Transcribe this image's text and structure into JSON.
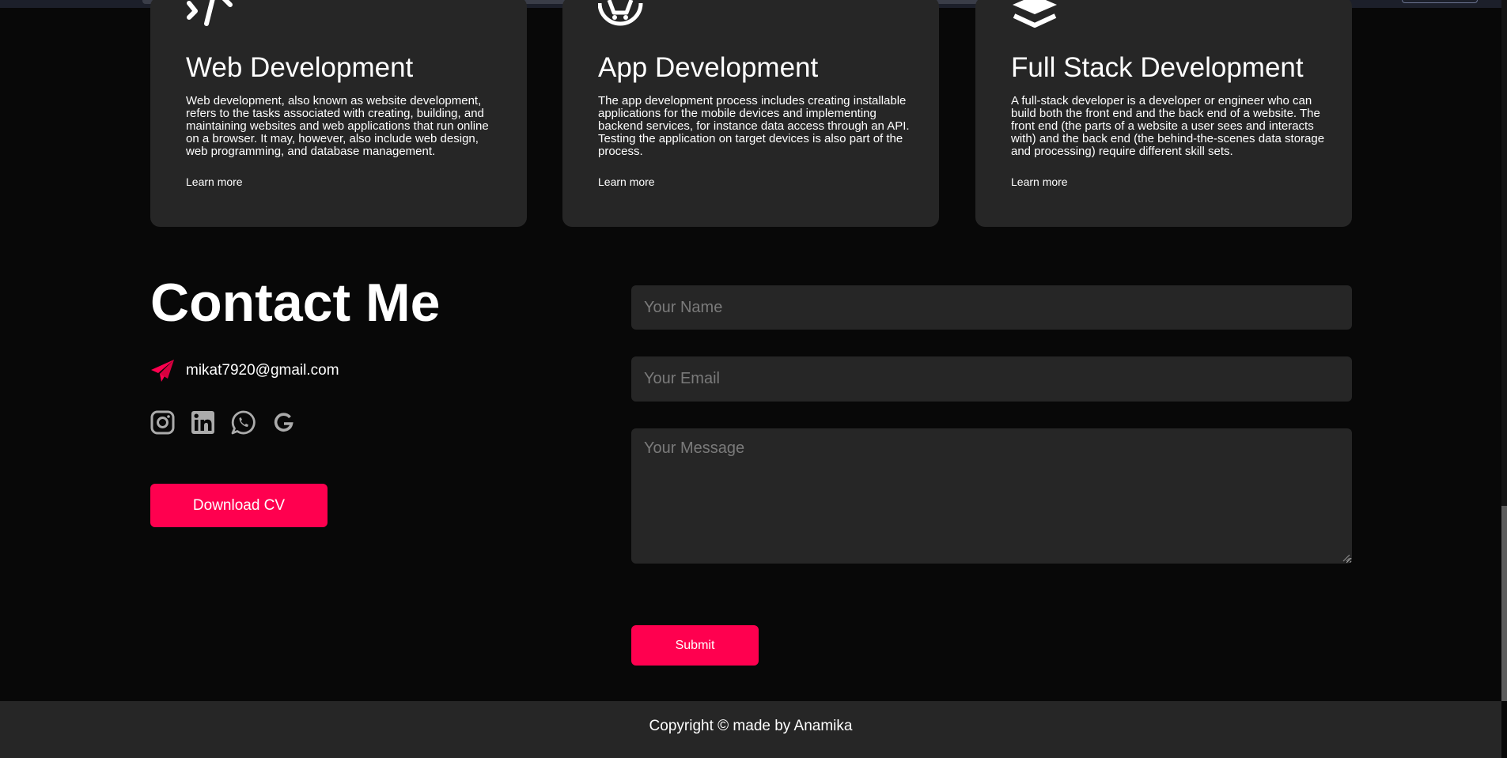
{
  "services": [
    {
      "icon": "code-icon",
      "title": "Web Development",
      "description": "Web development, also known as website development, refers to the tasks associated with creating, building, and maintaining websites and web applications that run online on a browser. It may, however, also include web design, web programming, and database management.",
      "link": "Learn more"
    },
    {
      "icon": "app-icon",
      "title": "App Development",
      "description": "The app development process includes creating installable applications for the mobile devices and implementing backend services, for instance data access through an API. Testing the application on target devices is also part of the process.",
      "link": "Learn more"
    },
    {
      "icon": "layers-icon",
      "title": "Full Stack Development",
      "description": "A full-stack developer is a developer or engineer who can build both the front end and the back end of a website. The front end (the parts of a website a user sees and interacts with) and the back end (the behind-the-scenes data storage and processing) require different skill sets.",
      "link": "Learn more"
    }
  ],
  "contact": {
    "title": "Contact Me",
    "email": "mikat7920@gmail.com",
    "socials": [
      "instagram-icon",
      "linkedin-icon",
      "whatsapp-icon",
      "google-icon"
    ],
    "download_label": "Download CV"
  },
  "form": {
    "name_placeholder": "Your Name",
    "email_placeholder": "Your Email",
    "message_placeholder": "Your Message",
    "submit_label": "Submit"
  },
  "footer": {
    "text": "Copyright © made by Anamika"
  },
  "colors": {
    "accent": "#ff004f",
    "background": "#080808",
    "card": "#262626",
    "icon_gray": "#ababab"
  }
}
